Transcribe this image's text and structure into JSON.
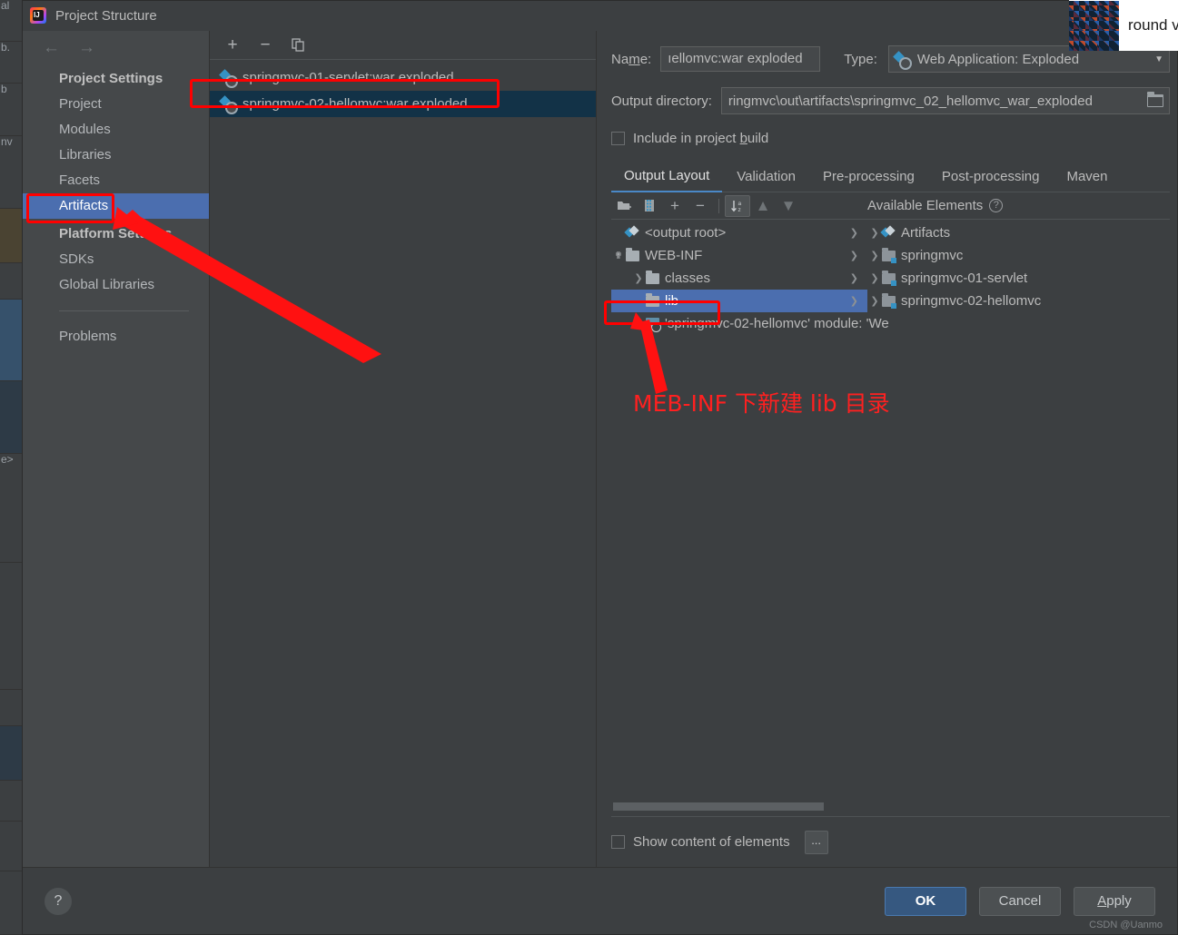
{
  "window": {
    "title": "Project Structure",
    "app_icon": "intellij-idea-icon"
  },
  "overlay_thumbnail": {
    "text": "round v"
  },
  "sidebar": {
    "nav": {
      "back": "←",
      "forward": "→"
    },
    "groups": [
      {
        "heading": "Project Settings",
        "items": [
          {
            "label": "Project",
            "selected": false
          },
          {
            "label": "Modules",
            "selected": false
          },
          {
            "label": "Libraries",
            "selected": false
          },
          {
            "label": "Facets",
            "selected": false
          },
          {
            "label": "Artifacts",
            "selected": true
          }
        ]
      },
      {
        "heading": "Platform Settings",
        "items": [
          {
            "label": "SDKs",
            "selected": false
          },
          {
            "label": "Global Libraries",
            "selected": false
          }
        ]
      }
    ],
    "problems": "Problems"
  },
  "artifacts_panel": {
    "toolbar": {
      "add": "+",
      "remove": "−",
      "copy": "copy-icon"
    },
    "rows": [
      {
        "label": "springmvc-01-servlet:war exploded",
        "selected": false
      },
      {
        "label": "springmvc-02-hellomvc:war exploded",
        "selected": true
      }
    ]
  },
  "detail": {
    "name_label": "Name:",
    "name_value": "ıellomvc:war exploded",
    "type_label": "Type:",
    "type_value": "Web Application: Exploded",
    "output_dir_label": "Output directory:",
    "output_dir_value": "ringmvc\\out\\artifacts\\springmvc_02_hellomvc_war_exploded",
    "include_in_build_label": "Include in project build",
    "include_in_build_checked": false,
    "tabs": [
      {
        "label": "Output Layout",
        "active": true
      },
      {
        "label": "Validation",
        "active": false
      },
      {
        "label": "Pre-processing",
        "active": false
      },
      {
        "label": "Post-processing",
        "active": false
      },
      {
        "label": "Maven",
        "active": false
      }
    ],
    "layout_toolbar": {
      "create_directory": "new-folder-icon",
      "create_archive": "new-archive-icon",
      "add_copy": "+",
      "remove": "−",
      "sort": "sort-az-icon",
      "move_up": "▲",
      "move_down": "▼"
    },
    "available_elements_label": "Available Elements",
    "available_elements_help": "?",
    "output_tree": [
      {
        "label": "<output root>",
        "icon": "artifact-icon",
        "indent": 0,
        "chevron": "none",
        "selected": false
      },
      {
        "label": "WEB-INF",
        "icon": "folder-icon",
        "indent": 1,
        "chevron": "down",
        "selected": false
      },
      {
        "label": "classes",
        "icon": "folder-icon",
        "indent": 2,
        "chevron": "right",
        "selected": false
      },
      {
        "label": "lib",
        "icon": "folder-icon",
        "indent": 2,
        "chevron": "none",
        "selected": true
      },
      {
        "label": "'springmvc-02-hellomvc' module: 'We",
        "icon": "module-output-icon",
        "indent": 2,
        "chevron": "none",
        "selected": false
      }
    ],
    "available_tree": [
      {
        "label": "Artifacts",
        "icon": "artifact-icon",
        "chevron": "right"
      },
      {
        "label": "springmvc",
        "icon": "module-folder-icon",
        "chevron": "right"
      },
      {
        "label": "springmvc-01-servlet",
        "icon": "module-folder-icon",
        "chevron": "right"
      },
      {
        "label": "springmvc-02-hellomvc",
        "icon": "module-folder-icon",
        "chevron": "right"
      }
    ],
    "show_content_label": "Show content of elements",
    "show_content_checked": false,
    "ellipsis_button": "..."
  },
  "footer": {
    "help": "?",
    "ok": "OK",
    "cancel": "Cancel",
    "apply": "Apply",
    "watermark": "CSDN @Uanmo"
  },
  "annotation": {
    "text": "MEB-INF 下新建 lib 目录",
    "color": "#ff2020"
  },
  "background_strips": [
    {
      "label": "al"
    },
    {
      "label": "b."
    },
    {
      "label": "b"
    },
    {
      "label": "nv"
    },
    {
      "label": ""
    },
    {
      "label": ""
    },
    {
      "label": ""
    },
    {
      "label": ""
    },
    {
      "label": "e>"
    }
  ],
  "colors": {
    "dialog_bg": "#3c3f41",
    "sidebar_bg": "#45484a",
    "selection_blue": "#4b6eaf",
    "list_selection_dark": "#123247",
    "accent_blue": "#3592c4",
    "primary_button": "#365880",
    "annotation_red": "#ff0000",
    "text": "#bbbbbb"
  }
}
